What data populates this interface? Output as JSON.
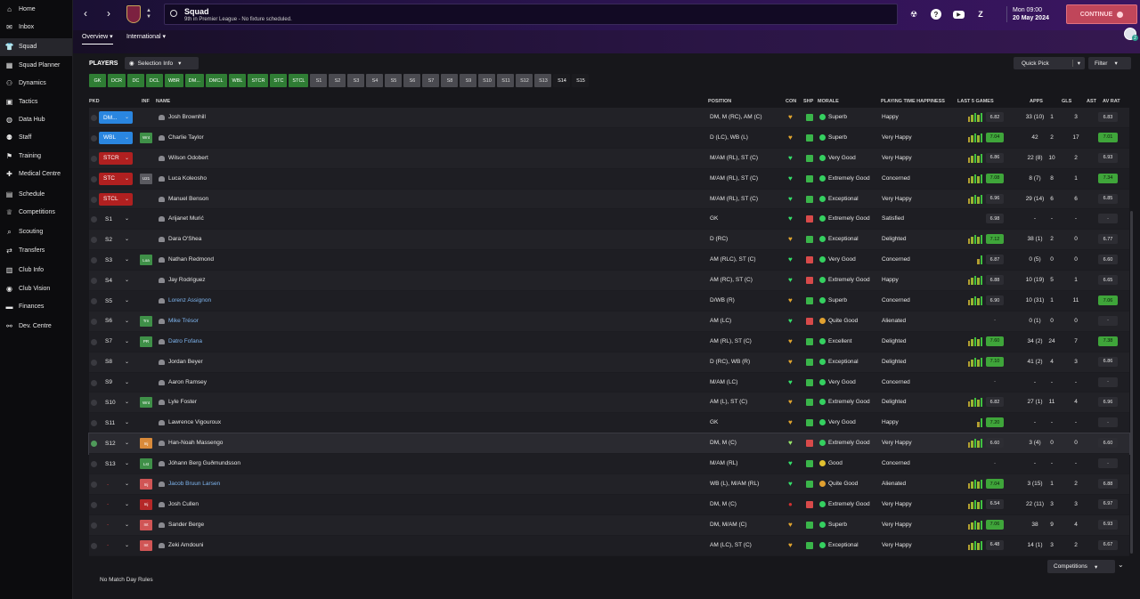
{
  "sidebar": {
    "items": [
      {
        "label": "Home",
        "icon": "home-icon",
        "glyph": "⌂"
      },
      {
        "label": "Inbox",
        "icon": "inbox-icon",
        "glyph": "✉"
      },
      {
        "label": "Squad",
        "icon": "shirt-icon",
        "glyph": "👕",
        "active": true
      },
      {
        "label": "Squad Planner",
        "icon": "planner-icon",
        "glyph": "▦"
      },
      {
        "label": "Dynamics",
        "icon": "dynamics-icon",
        "glyph": "⚇"
      },
      {
        "label": "Tactics",
        "icon": "tactics-icon",
        "glyph": "▣"
      },
      {
        "label": "Data Hub",
        "icon": "data-hub-icon",
        "glyph": "◍"
      },
      {
        "label": "Staff",
        "icon": "staff-icon",
        "glyph": "⚉"
      },
      {
        "label": "Training",
        "icon": "training-icon",
        "glyph": "⚑"
      },
      {
        "label": "Medical Centre",
        "icon": "medical-icon",
        "glyph": "✚"
      },
      {
        "label": "Schedule",
        "icon": "schedule-icon",
        "glyph": "▤"
      },
      {
        "label": "Competitions",
        "icon": "trophy-icon",
        "glyph": "♕"
      },
      {
        "label": "Scouting",
        "icon": "scouting-icon",
        "glyph": "⌕"
      },
      {
        "label": "Transfers",
        "icon": "transfers-icon",
        "glyph": "⇄"
      },
      {
        "label": "Club Info",
        "icon": "club-info-icon",
        "glyph": "▥"
      },
      {
        "label": "Club Vision",
        "icon": "club-vision-icon",
        "glyph": "◉"
      },
      {
        "label": "Finances",
        "icon": "finances-icon",
        "glyph": "▬"
      },
      {
        "label": "Dev. Centre",
        "icon": "dev-centre-icon",
        "glyph": "⚯"
      }
    ]
  },
  "header": {
    "title": "Squad",
    "subtitle": "9th in Premier League - No fixture scheduled.",
    "time": "Mon 09:00",
    "date": "20 May 2024",
    "continue_label": "CONTINUE",
    "avatar_badge": "2"
  },
  "subtabs": {
    "overview": "Overview",
    "international": "International"
  },
  "toolbar": {
    "players_label": "PLAYERS",
    "selection_info": "Selection Info",
    "quick_pick": "Quick Pick",
    "filter": "Filter"
  },
  "position_tabs": [
    {
      "label": "GK",
      "style": "g"
    },
    {
      "label": "DCR",
      "style": "g"
    },
    {
      "label": "DC",
      "style": "g"
    },
    {
      "label": "DCL",
      "style": "g"
    },
    {
      "label": "WBR",
      "style": "g"
    },
    {
      "label": "DM...",
      "style": "g"
    },
    {
      "label": "DMCL",
      "style": "g"
    },
    {
      "label": "WBL",
      "style": "g"
    },
    {
      "label": "STCR",
      "style": "g"
    },
    {
      "label": "STC",
      "style": "g"
    },
    {
      "label": "STCL",
      "style": "g"
    },
    {
      "label": "S1",
      "style": "s"
    },
    {
      "label": "S2",
      "style": "s"
    },
    {
      "label": "S3",
      "style": "s"
    },
    {
      "label": "S4",
      "style": "s"
    },
    {
      "label": "S5",
      "style": "s"
    },
    {
      "label": "S6",
      "style": "s"
    },
    {
      "label": "S7",
      "style": "s"
    },
    {
      "label": "S8",
      "style": "s"
    },
    {
      "label": "S9",
      "style": "s"
    },
    {
      "label": "S10",
      "style": "s"
    },
    {
      "label": "S11",
      "style": "s"
    },
    {
      "label": "S12",
      "style": "s"
    },
    {
      "label": "S13",
      "style": "s"
    },
    {
      "label": "S14",
      "style": "d"
    },
    {
      "label": "S15",
      "style": "d"
    }
  ],
  "table": {
    "headers": {
      "pkd": "PKD",
      "inf": "INF",
      "name": "NAME",
      "position": "POSITION",
      "con": "CON",
      "shp": "SHP",
      "morale": "MORALE",
      "pth": "PLAYING TIME HAPPINESS",
      "last5": "LAST 5 GAMES",
      "apps": "APPS",
      "gls": "GLS",
      "ast": "AST",
      "avrat": "AV RAT"
    },
    "rows": [
      {
        "pkd": "DM...",
        "pkd_style": "b",
        "inf": "",
        "name": "Josh Brownhill",
        "pos": "DM, M (RC), AM (C)",
        "con": "heart-half",
        "shp": "up",
        "morale": "Superb",
        "pth": "Happy",
        "last5": [
          3,
          4,
          5,
          4,
          5
        ],
        "l5": "6.82",
        "apps": "33 (10)",
        "gls": "1",
        "ast": "3",
        "avr": "6.83"
      },
      {
        "pkd": "WBL",
        "pkd_style": "b",
        "inf": "Wnt",
        "inf_style": "green",
        "name": "Charlie Taylor",
        "pos": "D (LC), WB (L)",
        "con": "heart-half",
        "shp": "up",
        "morale": "Superb",
        "pth": "Very Happy",
        "last5": [
          3,
          4,
          5,
          4,
          5
        ],
        "l5": "7.04",
        "apps": "42",
        "gls": "2",
        "ast": "17",
        "avr": "7.01"
      },
      {
        "pkd": "STCR",
        "pkd_style": "r",
        "inf": "",
        "name": "Wilson Odobert",
        "pos": "M/AM (RL), ST (C)",
        "con": "heart-full",
        "shp": "up",
        "morale": "Very Good",
        "pth": "Very Happy",
        "last5": [
          3,
          4,
          5,
          4,
          5
        ],
        "l5": "6.86",
        "apps": "22 (8)",
        "gls": "10",
        "ast": "2",
        "avr": "6.93"
      },
      {
        "pkd": "STC",
        "pkd_style": "r",
        "inf": "U21",
        "inf_style": "grey",
        "name": "Luca Koleosho",
        "pos": "M/AM (RL), ST (C)",
        "con": "heart-full",
        "shp": "up",
        "morale": "Extremely Good",
        "pth": "Concerned",
        "last5": [
          3,
          4,
          5,
          4,
          5
        ],
        "l5": "7.08",
        "apps": "8 (7)",
        "gls": "8",
        "ast": "1",
        "avr": "7.34"
      },
      {
        "pkd": "STCL",
        "pkd_style": "r",
        "inf": "",
        "name": "Manuel Benson",
        "pos": "M/AM (RL), ST (C)",
        "con": "heart-full",
        "shp": "up",
        "morale": "Exceptional",
        "pth": "Very Happy",
        "last5": [
          3,
          4,
          5,
          4,
          5
        ],
        "l5": "6.96",
        "apps": "29 (14)",
        "gls": "6",
        "ast": "6",
        "avr": "6.85"
      },
      {
        "pkd": "S1",
        "pkd_style": "n",
        "inf": "",
        "name": "Arijanet Murić",
        "pos": "GK",
        "con": "heart-full",
        "shp": "down",
        "morale": "Extremely Good",
        "pth": "Satisfied",
        "last5": [],
        "l5": "6.98",
        "apps": "-",
        "gls": "-",
        "ast": "-",
        "avr": "-"
      },
      {
        "pkd": "S2",
        "pkd_style": "n",
        "inf": "",
        "name": "Dara O'Shea",
        "pos": "D (RC)",
        "con": "heart-half",
        "shp": "up",
        "morale": "Exceptional",
        "pth": "Delighted",
        "last5": [
          3,
          4,
          5,
          4,
          5
        ],
        "l5": "7.12",
        "apps": "38 (1)",
        "gls": "2",
        "ast": "0",
        "avr": "6.77"
      },
      {
        "pkd": "S3",
        "pkd_style": "n",
        "inf": "Loa",
        "inf_style": "green",
        "name": "Nathan Redmond",
        "pos": "AM (RLC), ST (C)",
        "con": "heart-full",
        "shp": "down",
        "morale": "Very Good",
        "pth": "Concerned",
        "last5": [
          3,
          5
        ],
        "l5": "6.87",
        "apps": "0 (5)",
        "gls": "0",
        "ast": "0",
        "avr": "6.60"
      },
      {
        "pkd": "S4",
        "pkd_style": "n",
        "inf": "",
        "name": "Jay Rodriguez",
        "pos": "AM (RC), ST (C)",
        "con": "heart-full",
        "shp": "down",
        "morale": "Extremely Good",
        "pth": "Happy",
        "last5": [
          3,
          4,
          5,
          4,
          5
        ],
        "l5": "6.88",
        "apps": "10 (19)",
        "gls": "5",
        "ast": "1",
        "avr": "6.65"
      },
      {
        "pkd": "S5",
        "pkd_style": "n",
        "inf": "",
        "name": "Lorenz Assignon",
        "link": true,
        "pos": "D/WB (R)",
        "con": "heart-half",
        "shp": "up",
        "morale": "Superb",
        "pth": "Concerned",
        "last5": [
          3,
          4,
          5,
          4,
          5
        ],
        "l5": "6.90",
        "apps": "10 (31)",
        "gls": "1",
        "ast": "11",
        "avr": "7.06"
      },
      {
        "pkd": "S6",
        "pkd_style": "n",
        "inf": "Trn",
        "inf_style": "green",
        "name": "Mike Trésor",
        "link": true,
        "pos": "AM (LC)",
        "con": "heart-full",
        "shp": "down",
        "morale": "Quite Good",
        "pth": "Alienated",
        "last5": [],
        "l5": "-",
        "apps": "0 (1)",
        "gls": "0",
        "ast": "0",
        "avr": "-"
      },
      {
        "pkd": "S7",
        "pkd_style": "n",
        "inf": "PR",
        "inf_style": "green",
        "name": "Datro Fofana",
        "link": true,
        "pos": "AM (RL), ST (C)",
        "con": "heart-half",
        "shp": "up",
        "morale": "Excellent",
        "pth": "Delighted",
        "last5": [
          3,
          4,
          5,
          4,
          5
        ],
        "l5": "7.60",
        "apps": "34 (2)",
        "gls": "24",
        "ast": "7",
        "avr": "7.38"
      },
      {
        "pkd": "S8",
        "pkd_style": "n",
        "inf": "",
        "name": "Jordan Beyer",
        "pos": "D (RC), WB (R)",
        "con": "heart-half",
        "shp": "up",
        "morale": "Exceptional",
        "pth": "Delighted",
        "last5": [
          3,
          4,
          5,
          4,
          5
        ],
        "l5": "7.10",
        "apps": "41 (2)",
        "gls": "4",
        "ast": "3",
        "avr": "6.86"
      },
      {
        "pkd": "S9",
        "pkd_style": "n",
        "inf": "",
        "name": "Aaron Ramsey",
        "pos": "M/AM (LC)",
        "con": "heart-full",
        "shp": "up",
        "morale": "Very Good",
        "pth": "Concerned",
        "last5": [],
        "l5": "-",
        "apps": "-",
        "gls": "-",
        "ast": "-",
        "avr": "-"
      },
      {
        "pkd": "S10",
        "pkd_style": "n",
        "inf": "Wnt",
        "inf_style": "green",
        "name": "Lyle Foster",
        "pos": "AM (L), ST (C)",
        "con": "heart-half",
        "shp": "up",
        "morale": "Extremely Good",
        "pth": "Delighted",
        "last5": [
          3,
          4,
          5,
          4,
          5
        ],
        "l5": "6.82",
        "apps": "27 (1)",
        "gls": "11",
        "ast": "4",
        "avr": "6.96"
      },
      {
        "pkd": "S11",
        "pkd_style": "n",
        "inf": "",
        "name": "Lawrence Vigouroux",
        "pos": "GK",
        "con": "heart-half",
        "shp": "up",
        "morale": "Very Good",
        "pth": "Happy",
        "last5": [
          3,
          5
        ],
        "l5": "7.20",
        "apps": "-",
        "gls": "-",
        "ast": "-",
        "avr": "-"
      },
      {
        "pkd": "S12",
        "pkd_style": "n",
        "inf": "Inj",
        "inf_style": "orange",
        "name": "Han-Noah Massengo",
        "pos": "DM, M (C)",
        "con": "heart-light",
        "shp": "down",
        "morale": "Extremely Good",
        "pth": "Very Happy",
        "last5": [
          3,
          4,
          5,
          4,
          5
        ],
        "l5": "6.60",
        "apps": "3 (4)",
        "gls": "0",
        "ast": "0",
        "avr": "6.60",
        "selected": true
      },
      {
        "pkd": "S13",
        "pkd_style": "n",
        "inf": "Lst",
        "inf_style": "green",
        "name": "Jóhann Berg Guðmundsson",
        "pos": "M/AM (RL)",
        "con": "heart-full",
        "shp": "up",
        "morale": "Good",
        "pth": "Concerned",
        "last5": [],
        "l5": "-",
        "apps": "-",
        "gls": "-",
        "ast": "-",
        "avr": "-"
      },
      {
        "pkd": "-",
        "pkd_style": "dash",
        "inf": "Inj",
        "inf_style": "red",
        "name": "Jacob Bruun Larsen",
        "link": true,
        "pos": "WB (L), M/AM (RL)",
        "con": "heart-full",
        "shp": "up",
        "morale": "Quite Good",
        "pth": "Alienated",
        "last5": [
          3,
          4,
          5,
          4,
          5
        ],
        "l5": "7.04",
        "apps": "3 (15)",
        "gls": "1",
        "ast": "2",
        "avr": "6.88"
      },
      {
        "pkd": "-",
        "pkd_style": "dash",
        "inf": "Inj",
        "inf_style": "dred",
        "name": "Josh Cullen",
        "pos": "DM, M (C)",
        "con": "dot-red",
        "shp": "down",
        "morale": "Extremely Good",
        "pth": "Very Happy",
        "last5": [
          3,
          4,
          5,
          4,
          5
        ],
        "l5": "6.54",
        "apps": "22 (11)",
        "gls": "3",
        "ast": "3",
        "avr": "6.97"
      },
      {
        "pkd": "-",
        "pkd_style": "dash",
        "inf": "Int",
        "inf_style": "red",
        "name": "Sander Berge",
        "pos": "DM, M/AM (C)",
        "con": "heart-half",
        "shp": "up",
        "morale": "Superb",
        "pth": "Very Happy",
        "last5": [
          3,
          4,
          5,
          4,
          5
        ],
        "l5": "7.06",
        "apps": "38",
        "gls": "9",
        "ast": "4",
        "avr": "6.93"
      },
      {
        "pkd": "-",
        "pkd_style": "dash",
        "inf": "Int",
        "inf_style": "red",
        "name": "Zeki Amdouni",
        "pos": "AM (LC), ST (C)",
        "con": "heart-half",
        "shp": "up",
        "morale": "Exceptional",
        "pth": "Very Happy",
        "last5": [
          3,
          4,
          5,
          4,
          5
        ],
        "l5": "6.48",
        "apps": "14 (1)",
        "gls": "3",
        "ast": "2",
        "avr": "6.67"
      }
    ]
  },
  "footer": {
    "competitions": "Competitions",
    "no_rules": "No Match Day Rules"
  },
  "colors": {
    "green_tab": "#2f7d34",
    "pkd_blue": "#2a86e0",
    "pkd_red": "#b02020",
    "continue": "#c0465a",
    "rating_high": "#3fa53a",
    "rating_mid": "#2d2d33"
  }
}
